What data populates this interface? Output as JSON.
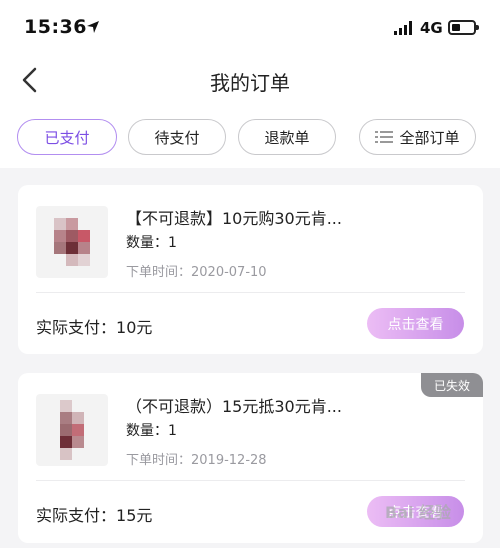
{
  "status_bar": {
    "time": "15:36",
    "network": "4G"
  },
  "nav": {
    "title": "我的订单"
  },
  "tabs": [
    {
      "label": "已支付",
      "active": true
    },
    {
      "label": "待支付",
      "active": false
    },
    {
      "label": "退款单",
      "active": false
    },
    {
      "label": "全部订单",
      "active": false,
      "icon": "list-icon"
    }
  ],
  "orders": [
    {
      "title": "【不可退款】10元购30元肯...",
      "quantity": "数量：1",
      "order_time": "下单时间：2020-07-10",
      "paid_label": "实际支付：",
      "paid_amount": "10元",
      "action": "点击查看"
    },
    {
      "title": "（不可退款）15元抵30元肯...",
      "quantity": "数量：1",
      "order_time": "下单时间：2019-12-28",
      "paid_label": "实际支付：",
      "paid_amount": "15元",
      "action": "点击查看",
      "badge": "已失效"
    }
  ],
  "watermark": "Bai 经验",
  "colors": {
    "accent": "#7c4ee4",
    "button_gradient_start": "#ecbdf5",
    "button_gradient_end": "#c78ee8",
    "expired": "#8f8f93"
  }
}
